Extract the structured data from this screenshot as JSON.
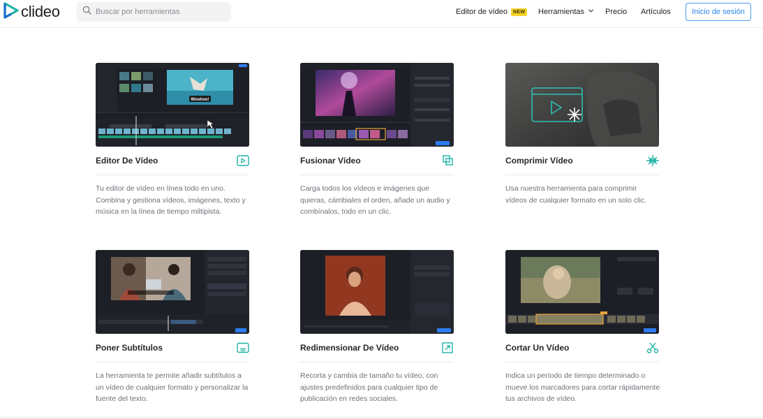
{
  "brand": {
    "name": "clideo",
    "logo_icon": "play-triangle-icon",
    "accent": "#1fb2a6"
  },
  "search": {
    "placeholder": "Buscar por herramientas",
    "icon": "search-icon"
  },
  "nav": {
    "editor_label": "Editor de vídeo",
    "editor_badge": "NEW",
    "tools_label": "Herramientas",
    "price_label": "Precio",
    "articles_label": "Artículos",
    "login_label": "Inicio de sesión"
  },
  "colors": {
    "login_border": "#4a9bf0",
    "badge_bg": "#f5d32c",
    "icon_teal": "#1fb2a6"
  },
  "cards": [
    {
      "title": "Editor De Vídeo",
      "icon": "play-window-icon",
      "description": "Tu editor de vídeo en línea todo en uno. Combina y gestiona vídeos, imágenes, texto y música en la línea de tiempo miltipista.",
      "preview_caption": "Woohoo!"
    },
    {
      "title": "Fusionar Vídeo",
      "icon": "merge-squares-icon",
      "description": "Carga todos los vídeos e imágenes que quieras, cámbiales el orden, añade un audio y combínalos, todo en un clic."
    },
    {
      "title": "Comprimir Vídeo",
      "icon": "compress-arrows-icon",
      "description": "Usa nuestra herramienta para comprimir vídeos de cualquier formato en un solo clic."
    },
    {
      "title": "Poner Subtítulos",
      "icon": "subtitles-icon",
      "description": "La herramienta te permite añadir subtítulos a un vídeo de cualquier formato y personalizar la fuente del texto."
    },
    {
      "title": "Redimensionar De Vídeo",
      "icon": "resize-arrow-icon",
      "description": "Recorta y cambia de tamaño tu vídeo, con ajustes predefinidos para cualquier tipo de publicación en redes sociales."
    },
    {
      "title": "Cortar Un Vídeo",
      "icon": "scissors-icon",
      "description": "Indica un período de tiempo determinado o mueve los marcadores para cortar rápidamente tus archivos de vídeo."
    }
  ]
}
